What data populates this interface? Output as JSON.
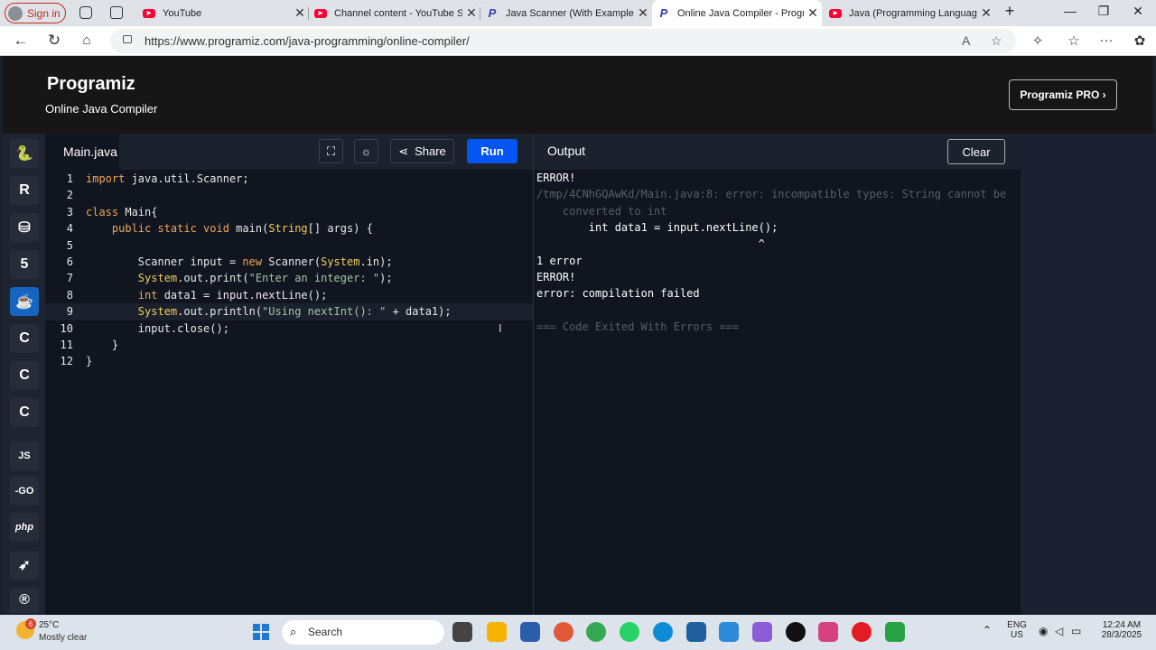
{
  "browser": {
    "signin_label": "Sign in",
    "tabs": [
      {
        "title": "YouTube",
        "favicon": "youtube-icon"
      },
      {
        "title": "Channel content - YouTube Stu",
        "favicon": "youtube-icon"
      },
      {
        "title": "Java Scanner (With Examples)",
        "favicon": "programiz-icon"
      },
      {
        "title": "Online Java Compiler - Program",
        "favicon": "programiz-icon",
        "active": true
      },
      {
        "title": "Java (Programming Language)",
        "favicon": "youtube-icon"
      }
    ],
    "url": "https://www.programiz.com/java-programming/online-compiler/"
  },
  "site": {
    "logo": "Programiz",
    "subtitle": "Online Java Compiler",
    "pro_button": "Programiz PRO ›"
  },
  "languages": [
    {
      "name": "python-icon",
      "label": "🐍"
    },
    {
      "name": "r-icon",
      "label": "R"
    },
    {
      "name": "sql-icon",
      "label": "⛁"
    },
    {
      "name": "html-icon",
      "label": "5"
    },
    {
      "name": "java-icon",
      "label": "☕",
      "active": true
    },
    {
      "name": "c-icon",
      "label": "C"
    },
    {
      "name": "cpp-icon",
      "label": "C"
    },
    {
      "name": "csharp-icon",
      "label": "C"
    },
    {
      "name": "js-icon",
      "label": "JS"
    },
    {
      "name": "go-icon",
      "label": "-GO"
    },
    {
      "name": "php-icon",
      "label": "php"
    },
    {
      "name": "swift-icon",
      "label": "➶"
    },
    {
      "name": "rust-icon",
      "label": "®"
    }
  ],
  "editor": {
    "filename": "Main.java",
    "share_label": "Share",
    "run_label": "Run",
    "lines": [
      {
        "n": "1",
        "text": "import java.util.Scanner;"
      },
      {
        "n": "2",
        "text": ""
      },
      {
        "n": "3",
        "text": "class Main{"
      },
      {
        "n": "4",
        "text": "    public static void main(String[] args) {"
      },
      {
        "n": "5",
        "text": ""
      },
      {
        "n": "6",
        "text": "        Scanner input = new Scanner(System.in);"
      },
      {
        "n": "7",
        "text": "        System.out.print(\"Enter an integer: \");"
      },
      {
        "n": "8",
        "text": "        int data1 = input.nextLine();"
      },
      {
        "n": "9",
        "text": "        System.out.println(\"Using nextInt(): \" + data1);"
      },
      {
        "n": "10",
        "text": "        input.close();"
      },
      {
        "n": "11",
        "text": "    }"
      },
      {
        "n": "12",
        "text": "}"
      }
    ]
  },
  "output": {
    "title": "Output",
    "clear_label": "Clear",
    "lines": [
      {
        "text": "ERROR!",
        "dim": false
      },
      {
        "text": "/tmp/4CNhGQAwKd/Main.java:8: error: incompatible types: String cannot be",
        "dim": true
      },
      {
        "text": "    converted to int",
        "dim": true
      },
      {
        "text": "        int data1 = input.nextLine();",
        "dim": false
      },
      {
        "text": "                                  ^",
        "dim": false
      },
      {
        "text": "1 error",
        "dim": false
      },
      {
        "text": "ERROR!",
        "dim": false
      },
      {
        "text": "error: compilation failed",
        "dim": false
      },
      {
        "text": "",
        "dim": false
      },
      {
        "text": "=== Code Exited With Errors ===",
        "dim": true
      }
    ]
  },
  "taskbar": {
    "weather_temp": "25°C",
    "weather_desc": "Mostly clear",
    "weather_badge": "6",
    "search_label": "Search",
    "lang_top": "ENG",
    "lang_bottom": "US",
    "time": "12:24 AM",
    "date": "28/3/2025"
  }
}
